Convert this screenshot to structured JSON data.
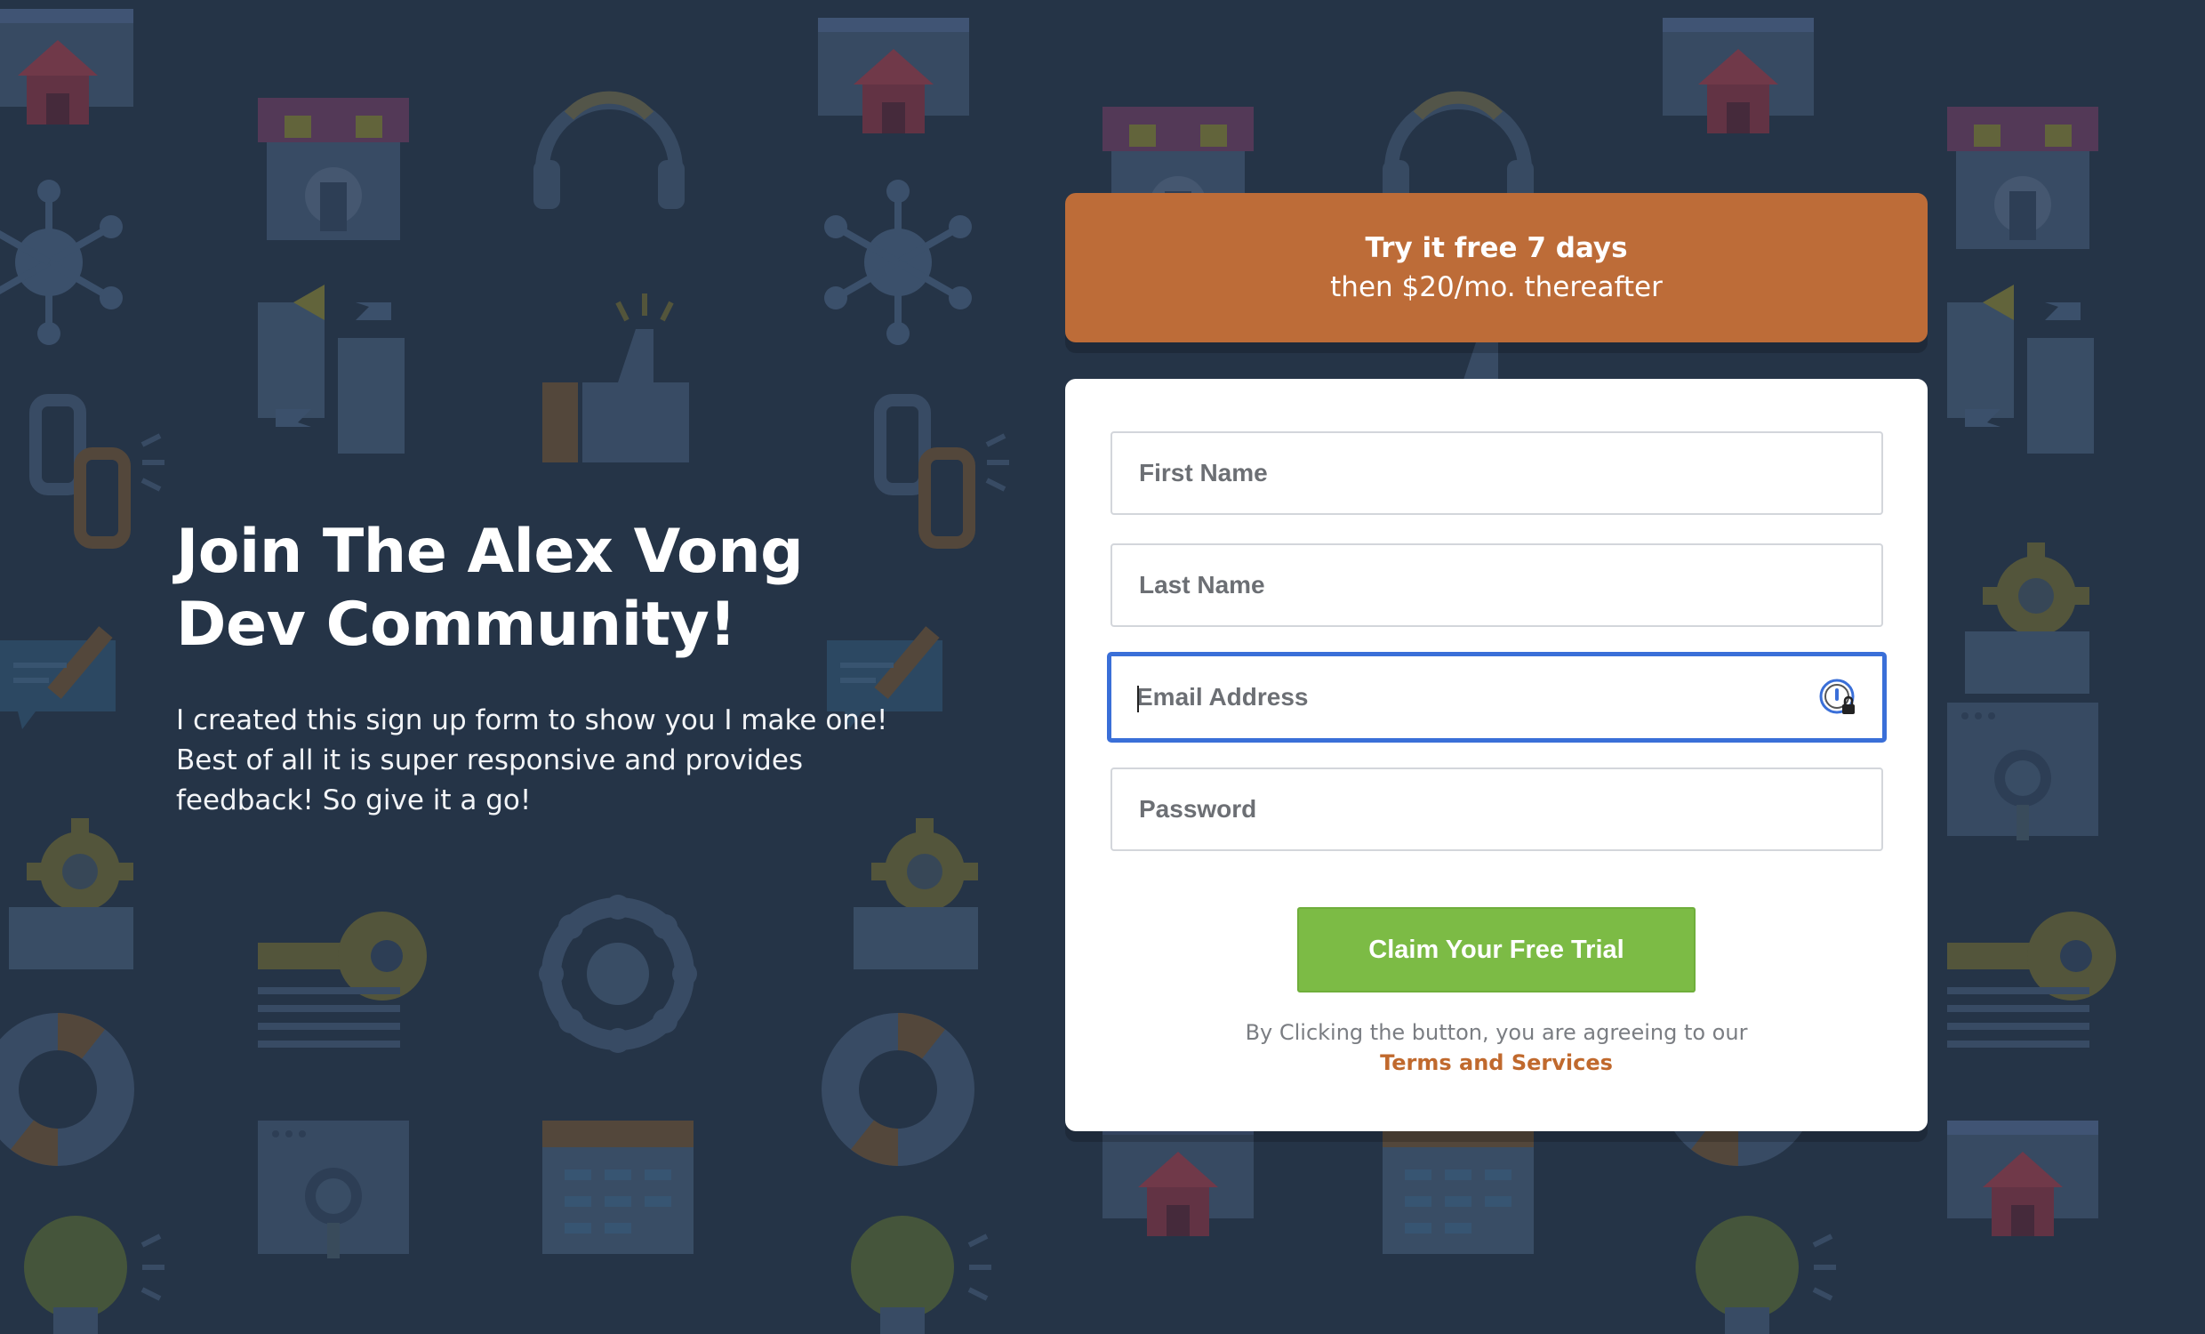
{
  "background": {
    "color": "#253447",
    "pattern_icons": [
      "house-icon",
      "store-icon",
      "headset-icon",
      "network-icon",
      "document-swap-icon",
      "thumbs-up-icon",
      "chain-link-icon",
      "folder-icon",
      "pencil-icon",
      "gear-icon",
      "rocket-icon",
      "cart-icon",
      "key-icon",
      "globe-icon",
      "lifebuoy-icon",
      "calendar-icon",
      "lightbulb-icon",
      "magnifier-icon"
    ]
  },
  "intro": {
    "title_line1": "Join The Alex Vong",
    "title_line2": "Dev Community!",
    "description": "I created this sign up form to show you I make one! Best of all it is super responsive and provides feedback! So give it a go!"
  },
  "offer": {
    "headline": "Try it free 7 days",
    "subline": "then $20/mo. thereafter",
    "color": "#bd6c38"
  },
  "form": {
    "first_name": {
      "placeholder": "First Name",
      "value": ""
    },
    "last_name": {
      "placeholder": "Last Name",
      "value": ""
    },
    "email": {
      "placeholder": "Email Address",
      "value": "",
      "focused": true
    },
    "password": {
      "placeholder": "Password",
      "value": ""
    },
    "submit_label": "Claim Your Free Trial",
    "submit_color": "#7cbb45",
    "legal_text": "By Clicking the button, you are agreeing to our",
    "legal_link": "Terms and Services",
    "password_manager_icon": "password-manager-icon"
  }
}
